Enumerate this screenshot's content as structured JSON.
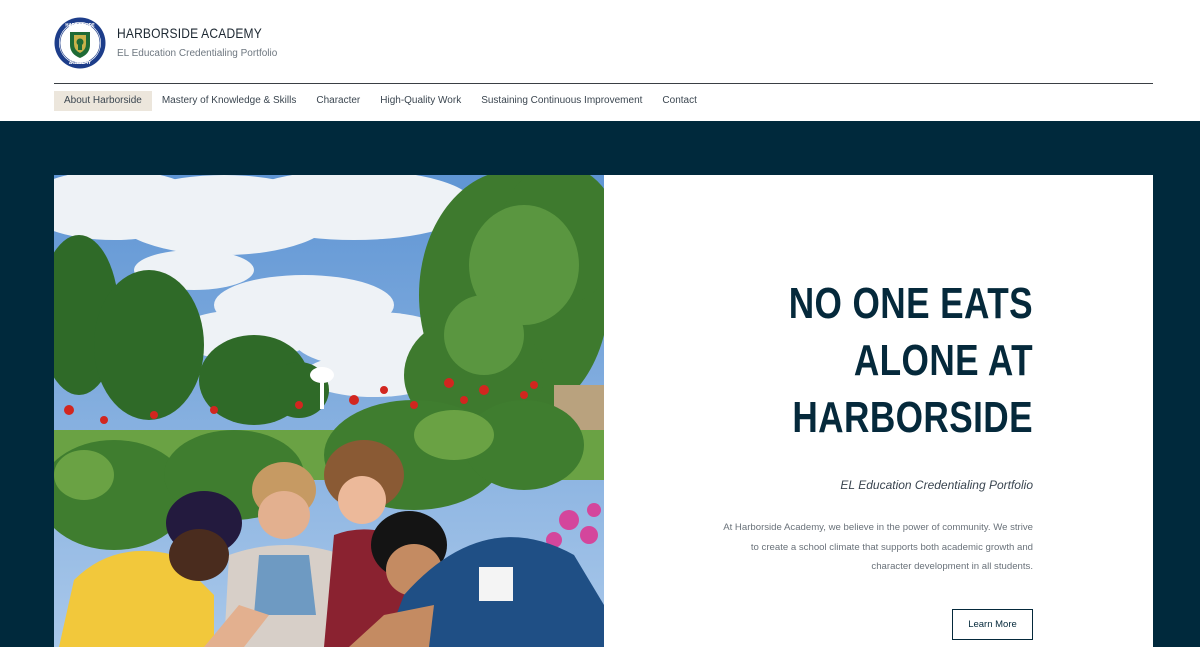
{
  "brand": {
    "title": "HARBORSIDE ACADEMY",
    "subtitle": "EL Education Credentialing Portfolio",
    "logo_text_top": "HARBORSIDE",
    "logo_text_bottom": "ACADEMY"
  },
  "nav": {
    "items": [
      {
        "label": "About Harborside",
        "active": true
      },
      {
        "label": "Mastery of Knowledge & Skills"
      },
      {
        "label": "Character"
      },
      {
        "label": "High-Quality Work"
      },
      {
        "label": "Sustaining Continuous Improvement"
      },
      {
        "label": "Contact"
      }
    ]
  },
  "hero": {
    "headline": [
      "NO ONE EATS",
      "ALONE AT",
      "HARBORSIDE"
    ],
    "subtitle": "EL Education Credentialing Portfolio",
    "body": "At Harborside Academy, we believe in the power of community. We strive to create a school climate that supports both academic growth and character development in all students.",
    "cta_label": "Learn More"
  },
  "colors": {
    "navy": "#00293c",
    "nav_active_bg": "#ece6dc"
  }
}
